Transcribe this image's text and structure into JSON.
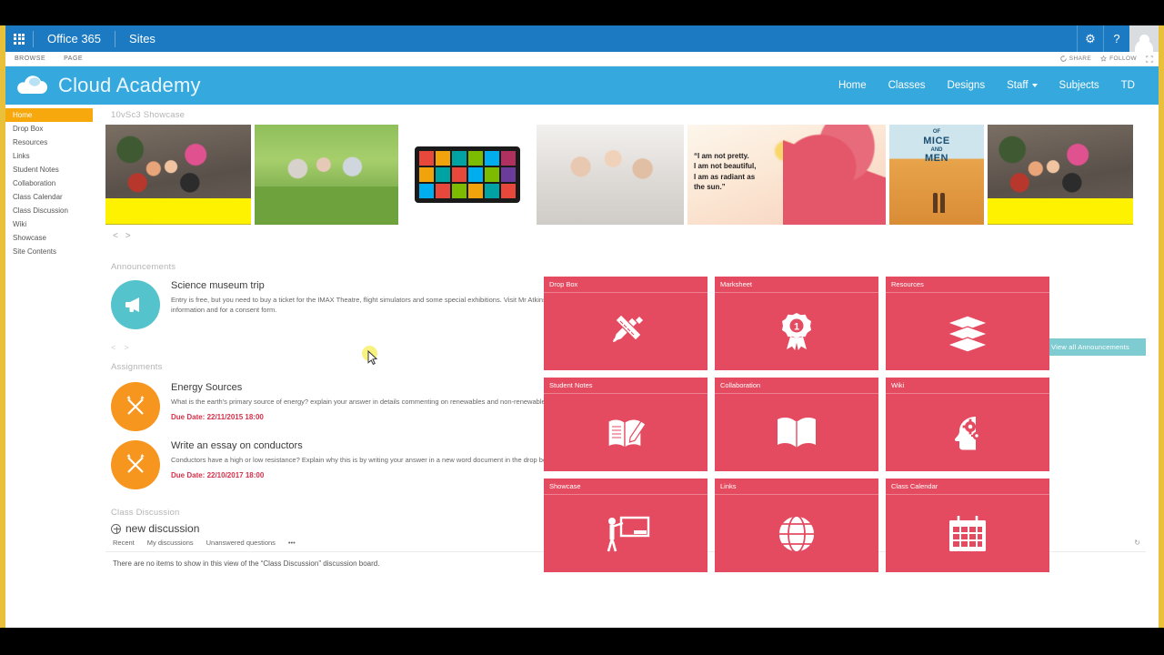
{
  "suitebar": {
    "waffle_label": "app-launcher",
    "brand": "Office 365",
    "app": "Sites",
    "settings_glyph": "⚙",
    "help_glyph": "?"
  },
  "ribbon": {
    "tabs": [
      "BROWSE",
      "PAGE"
    ],
    "share_label": "SHARE",
    "follow_label": "FOLLOW",
    "focus_label": ""
  },
  "site_header": {
    "title": "Cloud Academy",
    "nav": [
      {
        "label": "Home",
        "dropdown": false
      },
      {
        "label": "Classes",
        "dropdown": false
      },
      {
        "label": "Designs",
        "dropdown": false
      },
      {
        "label": "Staff",
        "dropdown": true
      },
      {
        "label": "Subjects",
        "dropdown": false
      },
      {
        "label": "TD",
        "dropdown": false
      }
    ]
  },
  "leftnav": {
    "items": [
      {
        "label": "Home",
        "selected": true
      },
      {
        "label": "Drop Box",
        "selected": false
      },
      {
        "label": "Resources",
        "selected": false
      },
      {
        "label": "Links",
        "selected": false
      },
      {
        "label": "Student Notes",
        "selected": false
      },
      {
        "label": "Collaboration",
        "selected": false
      },
      {
        "label": "Class Calendar",
        "selected": false
      },
      {
        "label": "Class Discussion",
        "selected": false
      },
      {
        "label": "Wiki",
        "selected": false
      },
      {
        "label": "Showcase",
        "selected": false
      },
      {
        "label": "Site Contents",
        "selected": false
      }
    ]
  },
  "showcase": {
    "heading": "10vSc3 Showcase",
    "prev_glyph": "<",
    "next_glyph": ">",
    "quote_line1": "“I am not pretty.",
    "quote_line2": "I am not beautiful,",
    "quote_line3": "I am as radiant as",
    "quote_line4": "the sun.”",
    "mice_of": "OF",
    "mice_mice": "MICE",
    "mice_and": "AND",
    "mice_men": "MEN"
  },
  "announcements": {
    "heading": "Announcements",
    "item_title": "Science museum trip",
    "item_body": "Entry is free, but you need to buy a ticket for the IMAX Theatre, flight simulators and some special exhibitions. Visit Mr Atkinson in E4 for more information and for a consent form.",
    "prev_glyph": "<",
    "next_glyph": ">",
    "view_all_label": "View all Announcements"
  },
  "assignments": {
    "heading": "Assignments",
    "items": [
      {
        "title": "Energy Sources",
        "body": "What is the earth's primary source of energy? explain your answer in details commenting on renewables and non-renewable methods.",
        "due": "Due Date: 22/11/2015 18:00"
      },
      {
        "title": "Write an essay on conductors",
        "body": "Conductors have a high or low resistance? Explain why this is by writing your answer in a new word document in the drop box folder.",
        "due": "Due Date: 22/10/2017 18:00"
      }
    ]
  },
  "discussion": {
    "heading": "Class Discussion",
    "new_label": "new discussion",
    "tabs": [
      "Recent",
      "My discussions",
      "Unanswered questions",
      "•••"
    ],
    "refresh_glyph": "↻",
    "empty_text": "There are no items to show in this view of the “Class Discussion” discussion board."
  },
  "tiles": {
    "accent": "#e54b60",
    "items": [
      {
        "label": "Drop Box",
        "icon": "pencil-ruler-icon"
      },
      {
        "label": "Marksheet",
        "icon": "award-ribbon-icon"
      },
      {
        "label": "Resources",
        "icon": "books-stack-icon"
      },
      {
        "label": "Student Notes",
        "icon": "notebook-pencil-icon"
      },
      {
        "label": "Collaboration",
        "icon": "open-book-icon"
      },
      {
        "label": "Wiki",
        "icon": "head-gears-icon"
      },
      {
        "label": "Showcase",
        "icon": "presenter-board-icon"
      },
      {
        "label": "Links",
        "icon": "globe-icon"
      },
      {
        "label": "Class Calendar",
        "icon": "calendar-icon"
      }
    ]
  },
  "colors": {
    "suitebar": "#1b7ac2",
    "site_header": "#35a8dd",
    "nav_selected": "#f6a80d",
    "tile_red": "#e54b60",
    "due_red": "#d6304a",
    "teal": "#55c3cc",
    "orange": "#f7961e"
  }
}
